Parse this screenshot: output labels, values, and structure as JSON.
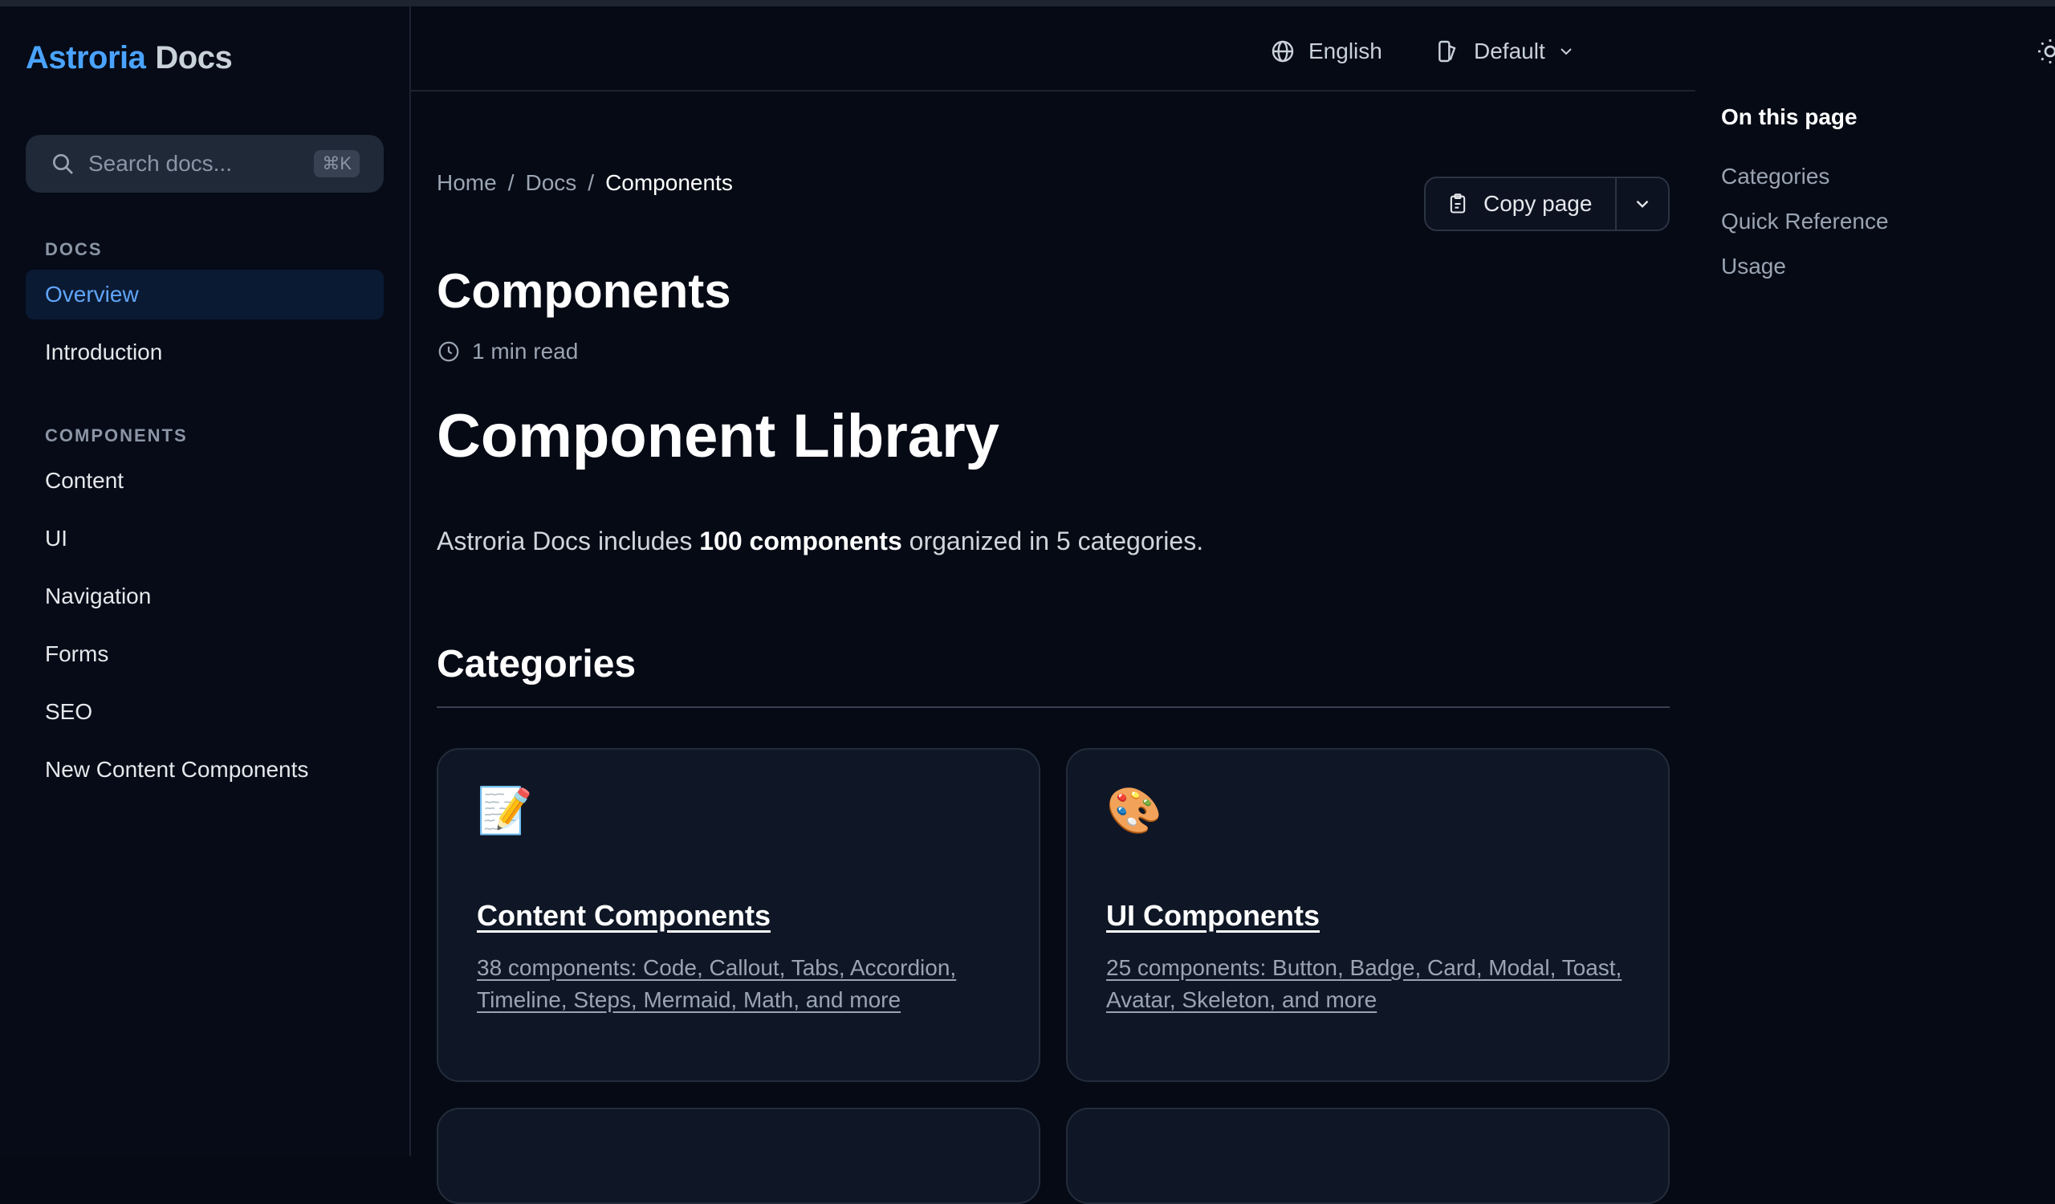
{
  "brand": {
    "primary": "Astroria",
    "secondary": "Docs"
  },
  "search": {
    "placeholder": "Search docs...",
    "shortcut": "⌘K"
  },
  "sidebar": {
    "sections": [
      {
        "heading": "DOCS",
        "items": [
          {
            "label": "Overview",
            "active": true
          },
          {
            "label": "Introduction",
            "active": false
          }
        ]
      },
      {
        "heading": "COMPONENTS",
        "items": [
          {
            "label": "Content"
          },
          {
            "label": "UI"
          },
          {
            "label": "Navigation"
          },
          {
            "label": "Forms"
          },
          {
            "label": "SEO"
          },
          {
            "label": "New Content Components"
          }
        ]
      }
    ]
  },
  "header": {
    "language": "English",
    "theme": "Default"
  },
  "breadcrumb": [
    "Home",
    "Docs",
    "Components"
  ],
  "copy_button": {
    "label": "Copy page"
  },
  "page": {
    "title": "Components",
    "read_time": "1 min read",
    "heading": "Component Library",
    "intro_prefix": "Astroria Docs includes ",
    "intro_bold": "100 components",
    "intro_suffix": " organized in 5 categories.",
    "section_heading": "Categories"
  },
  "cards": [
    {
      "emoji": "📝",
      "title": "Content Components",
      "description": "38 components: Code, Callout, Tabs, Accordion, Timeline, Steps, Mermaid, Math, and more"
    },
    {
      "emoji": "🎨",
      "title": "UI Components",
      "description": "25 components: Button, Badge, Card, Modal, Toast, Avatar, Skeleton, and more"
    }
  ],
  "toc": {
    "title": "On this page",
    "items": [
      "Categories",
      "Quick Reference",
      "Usage"
    ]
  },
  "colors": {
    "background": "#050a15",
    "brand_blue": "#4aa3ff",
    "active_nav_bg": "#0b1a33",
    "card_bg": "#0f1726"
  }
}
